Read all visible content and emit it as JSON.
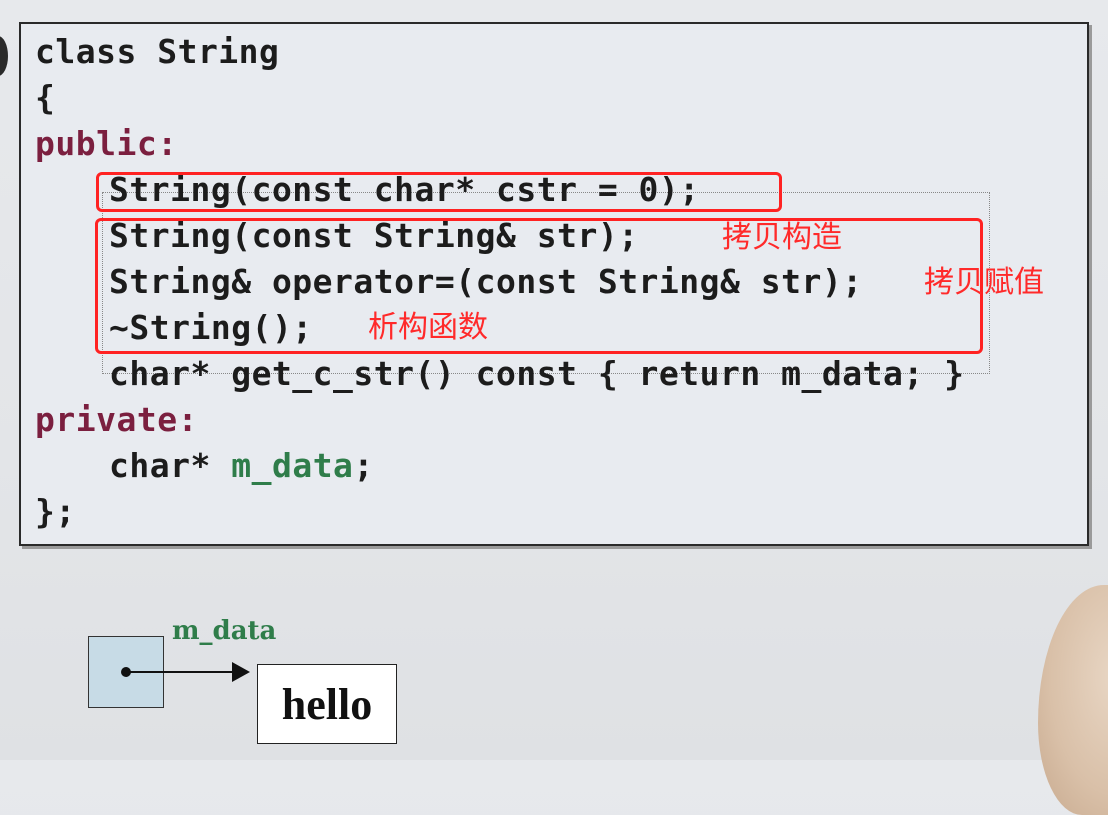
{
  "code": {
    "line1": "class String",
    "line2": "{",
    "line3": "public:",
    "line4": "String(const char* cstr = 0);",
    "line5": "String(const String& str);",
    "line6": "String& operator=(const String& str);",
    "line7": "~String();",
    "line8_pre": "char* get_c_str() const { return m_data; }",
    "line9": "private:",
    "line10_type": "char* ",
    "line10_member": "m_data",
    "line10_end": ";",
    "line11": "};"
  },
  "annotations": {
    "copy_ctor": "拷贝构造",
    "copy_assign": "拷贝赋值",
    "destructor": "析构函数"
  },
  "diagram": {
    "pointer_label": "m_data",
    "target_text": "hello"
  },
  "colors": {
    "access_keyword": "#7b1f3f",
    "member": "#2f7d4a",
    "highlight": "#ff2222"
  }
}
